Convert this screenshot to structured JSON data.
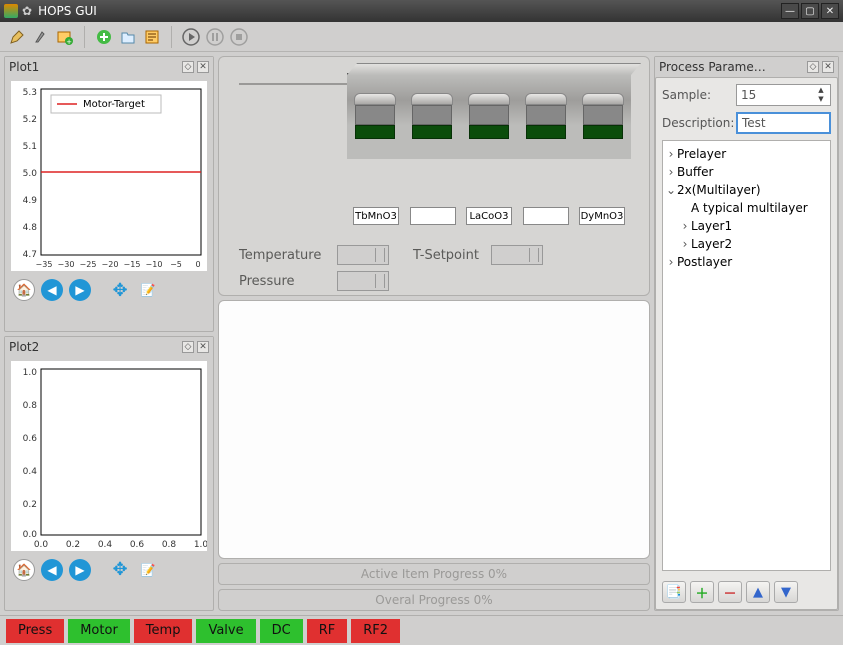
{
  "window": {
    "title": "HOPS GUI"
  },
  "toolbar": {
    "icons": [
      "edit",
      "pick",
      "image-add",
      "add",
      "open",
      "script",
      "play",
      "pause",
      "stop"
    ]
  },
  "left": {
    "plot1": {
      "title": "Plot1",
      "legend": "Motor-Target",
      "yticks": [
        "5.3",
        "5.2",
        "5.1",
        "5.0",
        "4.9",
        "4.8",
        "4.7"
      ],
      "xticks": [
        "−35",
        "−30",
        "−25",
        "−20",
        "−15",
        "−10",
        "−5",
        "0"
      ]
    },
    "plot2": {
      "title": "Plot2",
      "yticks": [
        "1.0",
        "0.8",
        "0.6",
        "0.4",
        "0.2",
        "0.0"
      ],
      "xticks": [
        "0.0",
        "0.2",
        "0.4",
        "0.6",
        "0.8",
        "1.0"
      ]
    }
  },
  "center": {
    "cassettes": [
      "TbMnO3",
      "",
      "LaCoO3",
      "",
      "DyMnO3"
    ],
    "labels": {
      "temperature": "Temperature",
      "pressure": "Pressure",
      "tsetpoint": "T-Setpoint"
    },
    "progress_active": "Active Item Progress 0%",
    "progress_overall": "Overal Progress 0%"
  },
  "right": {
    "title": "Process Parame…",
    "sample_label": "Sample:",
    "sample_value": "15",
    "description_label": "Description:",
    "description_value": "Test",
    "tree": [
      {
        "level": 0,
        "exp": ">",
        "label": "Prelayer"
      },
      {
        "level": 0,
        "exp": ">",
        "label": "Buffer"
      },
      {
        "level": 0,
        "exp": "v",
        "label": "2x(Multilayer)"
      },
      {
        "level": 1,
        "exp": "",
        "label": "A typical multilayer"
      },
      {
        "level": 1,
        "exp": ">",
        "label": "Layer1"
      },
      {
        "level": 1,
        "exp": ">",
        "label": "Layer2"
      },
      {
        "level": 0,
        "exp": ">",
        "label": "Postlayer"
      }
    ]
  },
  "status": [
    {
      "label": "Press",
      "color": "red"
    },
    {
      "label": "Motor",
      "color": "green"
    },
    {
      "label": "Temp",
      "color": "red"
    },
    {
      "label": "Valve",
      "color": "green"
    },
    {
      "label": "DC",
      "color": "green"
    },
    {
      "label": "RF",
      "color": "red"
    },
    {
      "label": "RF2",
      "color": "red"
    }
  ],
  "chart_data": [
    {
      "type": "line",
      "title": "Plot1",
      "series": [
        {
          "name": "Motor-Target",
          "x": [
            -35,
            0
          ],
          "y": [
            5.0,
            5.0
          ],
          "color": "#d22"
        }
      ],
      "xlim": [
        -35,
        0
      ],
      "ylim": [
        4.7,
        5.3
      ]
    },
    {
      "type": "line",
      "title": "Plot2",
      "series": [],
      "xlim": [
        0.0,
        1.0
      ],
      "ylim": [
        0.0,
        1.0
      ]
    }
  ]
}
